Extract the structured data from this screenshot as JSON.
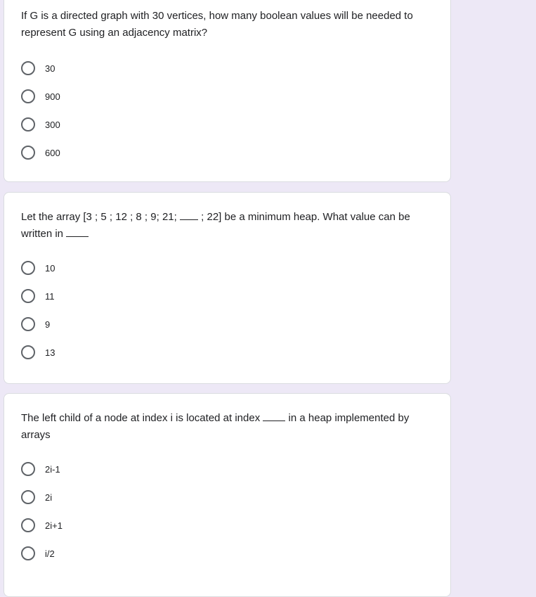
{
  "questions": [
    {
      "text": "If G is a directed graph with 30 vertices, how many boolean values will be needed to represent G using an adjacency matrix?",
      "options": [
        "30",
        "900",
        "300",
        "600"
      ]
    },
    {
      "text_a": "Let the array [3 ; 5 ; 12 ; 8 ; 9; 21; ",
      "text_b": " ; 22] be a minimum heap. What value can be written in ",
      "options": [
        "10",
        "11",
        "9",
        "13"
      ]
    },
    {
      "text_a": "The left child of a node at index i is located at index ",
      "text_b": " in a heap implemented by arrays",
      "options": [
        "2i-1",
        "2i",
        "2i+1",
        "i/2"
      ]
    }
  ]
}
